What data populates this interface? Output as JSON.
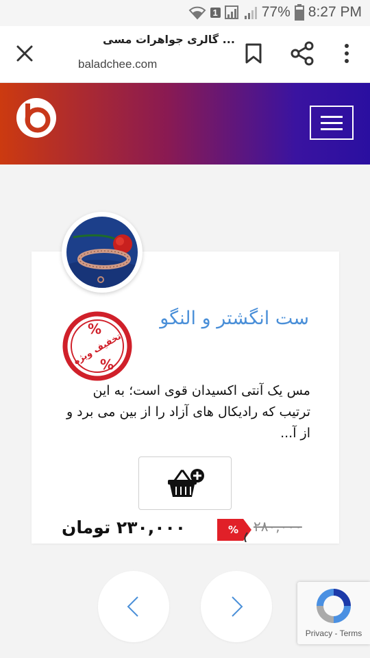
{
  "status_bar": {
    "sim_badge": "1",
    "battery": "77%",
    "time": "8:27 PM"
  },
  "browser": {
    "page_title": "گالری جواهرات مسی ...",
    "url": "baladchee.com"
  },
  "product": {
    "title": "ست انگشتر و النگو",
    "badge_text": "تخفیف ویژه",
    "description": "مس یک آنتی اکسیدان قوی است؛ به این ترتیب که رادیکال های آزاد را از بین می برد و از آ...",
    "price": "۲۳۰,۰۰۰ تومان",
    "old_price": "۲۸۰,۰۰۰"
  },
  "recaptcha": {
    "privacy": "Privacy",
    "separator": " - ",
    "terms": "Terms"
  },
  "colors": {
    "header_gradient_start": "#cc3a10",
    "header_gradient_end": "#2a0fa0",
    "title_blue": "#4a8fd8",
    "badge_red": "#d0202a"
  },
  "icons": [
    "wifi-icon",
    "signal-icon",
    "close-icon",
    "bookmark-icon",
    "share-icon",
    "more-icon",
    "menu-icon",
    "add-to-cart-icon",
    "chevron-left-icon",
    "chevron-right-icon",
    "recaptcha-icon"
  ]
}
